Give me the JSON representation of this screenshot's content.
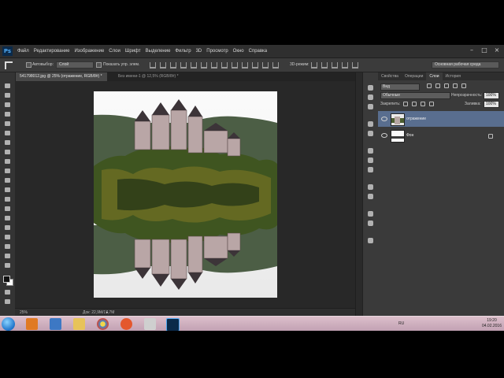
{
  "app": {
    "logo": "Ps"
  },
  "menu": [
    "Файл",
    "Редактирование",
    "Изображение",
    "Слои",
    "Шрифт",
    "Выделение",
    "Фильтр",
    "3D",
    "Просмотр",
    "Окно",
    "Справка"
  ],
  "options": {
    "autoselect_label": "Автовыбор:",
    "autoselect_value": "Слой",
    "show_controls_label": "Показать упр. элем.",
    "mode3d_label": "3D-режим:",
    "workspace_value": "Основная рабочая среда"
  },
  "tabs": [
    {
      "label": "541798012.jpg @ 25% (отражение, RGB/8#) *",
      "active": true
    },
    {
      "label": "Без имени-1 @ 12,5% (RGB/8#) *",
      "active": false
    }
  ],
  "status": {
    "zoom": "25%",
    "doc": "Док: 22,9M/17,7M"
  },
  "panel": {
    "tabs": [
      {
        "label": "Свойства",
        "active": false
      },
      {
        "label": "Операции",
        "active": false
      },
      {
        "label": "Слои",
        "active": true
      },
      {
        "label": "История",
        "active": false
      }
    ],
    "kind_value": "Вид",
    "blend_mode": "Обычные",
    "opacity_label": "Непрозрачность:",
    "opacity_value": "100%",
    "lock_label": "Закрепить:",
    "fill_label": "Заливка:",
    "fill_value": "100%",
    "layers": [
      {
        "name": "отражение",
        "selected": true
      },
      {
        "name": "Фон",
        "selected": false
      }
    ]
  },
  "taskbar": {
    "lang": "RU",
    "time": "19:20",
    "date": "04.02.2016",
    "apps": [
      "windows-media-player-icon",
      "folder-icon",
      "firefox-icon",
      "chrome-icon",
      "opera-icon",
      "network-icon",
      "photoshop-icon",
      "video-player-icon"
    ]
  }
}
